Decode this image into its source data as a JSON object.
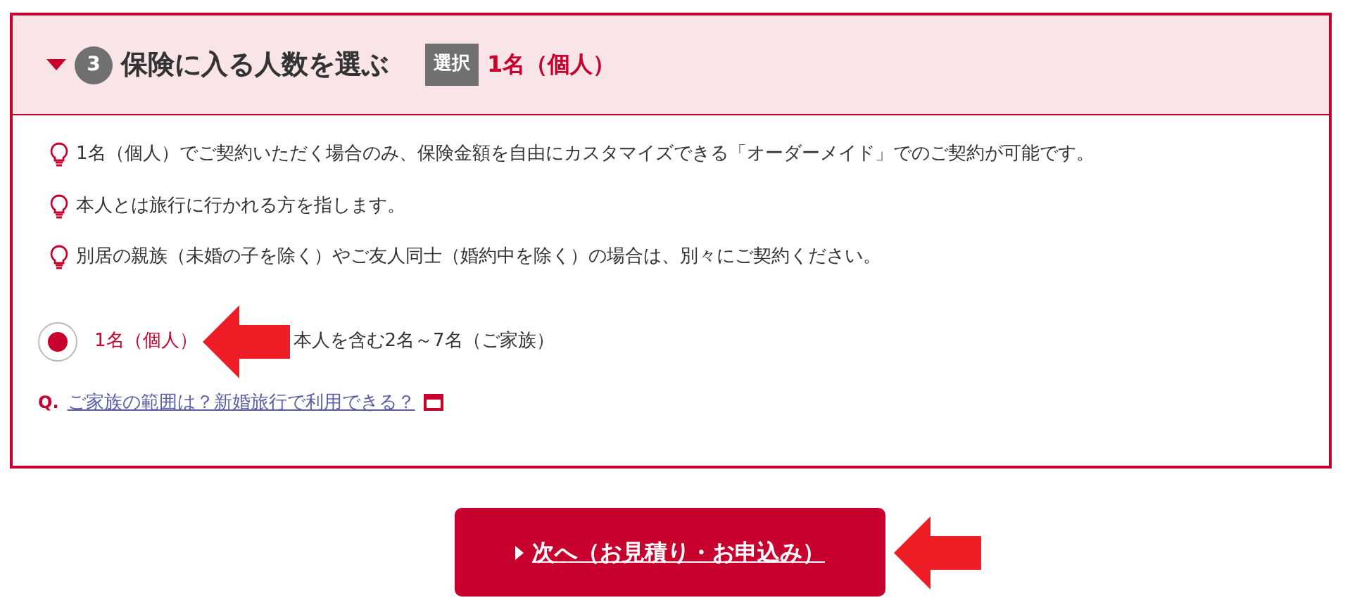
{
  "section": {
    "expanded": true,
    "number": "3",
    "title": "保険に入る人数を選ぶ",
    "badge": "選択",
    "selection": "1名（個人）"
  },
  "notes": [
    "1名（個人）でご契約いただく場合のみ、保険金額を自由にカスタマイズできる「オーダーメイド」でのご契約が可能です。",
    "本人とは旅行に行かれる方を指します。",
    "別居の親族（未婚の子を除く）やご友人同士（婚約中を除く）の場合は、別々にご契約ください。"
  ],
  "options": [
    {
      "kind": "radio",
      "label": "1名（個人）",
      "selected": true
    },
    {
      "kind": "label_only",
      "label": "本人を含む2名～7名（ご家族）",
      "selected": false
    }
  ],
  "faq": {
    "prefix": "Q.",
    "link": "ご家族の範囲は？新婚旅行で利用できる？"
  },
  "next_button": "次へ（お見積り・お申込み）"
}
